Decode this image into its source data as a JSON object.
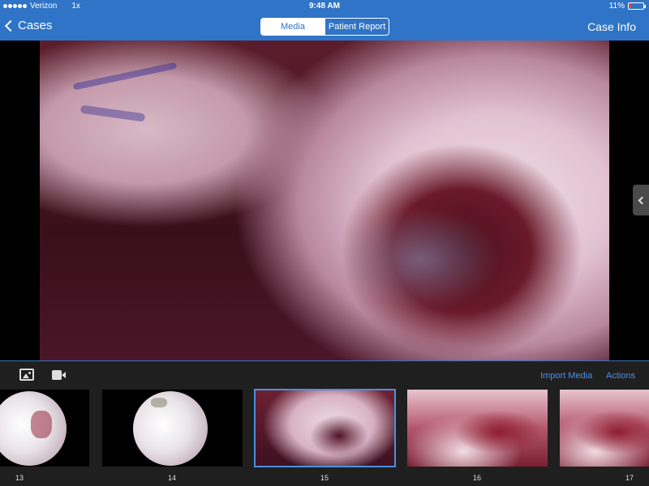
{
  "status_bar": {
    "carrier": "Verizon",
    "speed": "1x",
    "time": "9:48 AM",
    "battery_label": "11%",
    "battery_level": 0.11
  },
  "navbar": {
    "back_label": "Cases",
    "tabs": [
      {
        "label": "Media",
        "active": true
      },
      {
        "label": "Patient Report",
        "active": false
      }
    ],
    "right_label": "Case Info"
  },
  "toolbar": {
    "photo_icon": "photo-icon",
    "video_icon": "video-camera-icon",
    "import_label": "Import Media",
    "actions_label": "Actions"
  },
  "thumbnails": [
    {
      "number": "13",
      "kind": "arthroscopic",
      "selected": false
    },
    {
      "number": "14",
      "kind": "arthroscopic",
      "selected": false
    },
    {
      "number": "15",
      "kind": "surgical-photo",
      "selected": true
    },
    {
      "number": "16",
      "kind": "surgical-photo",
      "selected": false
    },
    {
      "number": "17",
      "kind": "surgical-photo",
      "selected": false
    }
  ],
  "colors": {
    "accent": "#2f74c6",
    "link": "#4a90e2",
    "panel": "#1f1f1f"
  }
}
